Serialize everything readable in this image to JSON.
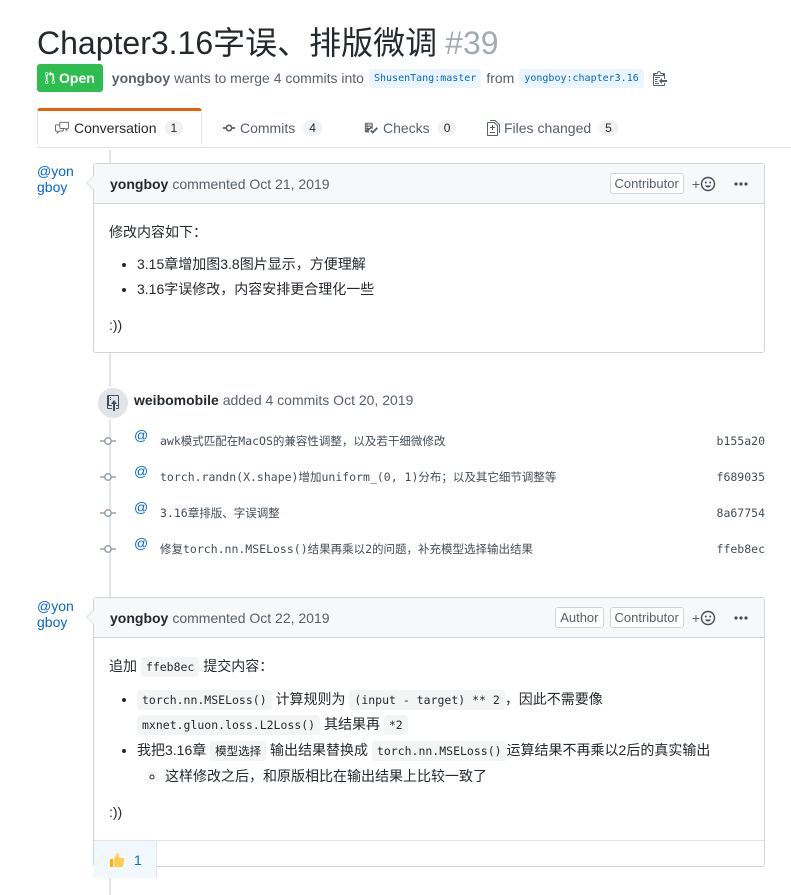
{
  "pr": {
    "title": "Chapter3.16字误、排版微调",
    "number": "#39",
    "state": "Open",
    "author": "yongboy",
    "merge_text": "wants to merge 4 commits into",
    "base_branch": "ShusenTang:master",
    "from_text": "from",
    "head_branch": "yongboy:chapter3.16"
  },
  "tabs": [
    {
      "label": "Conversation",
      "count": "1",
      "icon": "comment-discussion-icon"
    },
    {
      "label": "Commits",
      "count": "4",
      "icon": "git-commit-icon"
    },
    {
      "label": "Checks",
      "count": "0",
      "icon": "checklist-icon"
    },
    {
      "label": "Files changed",
      "count": "5",
      "icon": "file-diff-icon"
    }
  ],
  "comment1": {
    "avatar_line1": "@yon",
    "avatar_line2": "gboy",
    "author": "yongboy",
    "action": "commented Oct 21, 2019",
    "label": "Contributor",
    "intro": "修改内容如下：",
    "items": [
      "3.15章增加图3.8图片显示，方便理解",
      "3.16字误修改，内容安排更合理化一些"
    ],
    "outro": ":))"
  },
  "event": {
    "author": "weibomobile",
    "action": "added 4 commits Oct 20, 2019",
    "commits": [
      {
        "avatar": "@",
        "message": "awk模式匹配在MacOS的兼容性调整，以及若干细微修改",
        "sha": "b155a20"
      },
      {
        "avatar": "@",
        "message": "torch.randn(X.shape)增加uniform_(0, 1)分布；以及其它细节调整等",
        "sha": "f689035"
      },
      {
        "avatar": "@",
        "message": "3.16章排版、字误调整",
        "sha": "8a67754"
      },
      {
        "avatar": "@",
        "message": "修复torch.nn.MSELoss()结果再乘以2的问题，补充模型选择输出结果",
        "sha": "ffeb8ec"
      }
    ]
  },
  "comment2": {
    "avatar_line1": "@yon",
    "avatar_line2": "gboy",
    "author": "yongboy",
    "action": "commented Oct 22, 2019",
    "label_author": "Author",
    "label_contrib": "Contributor",
    "intro_prefix": "追加",
    "intro_code": "ffeb8ec",
    "intro_suffix": "提交内容：",
    "b1_code1": "torch.nn.MSELoss()",
    "b1_t1": "计算规则为",
    "b1_code2": "(input - target) ** 2",
    "b1_t2": "，因此不需要像",
    "b1_code3": "mxnet.gluon.loss.L2Loss()",
    "b1_t3": "其结果再",
    "b1_code4": "*2",
    "b2_t1": "我把3.16章",
    "b2_code1": "模型选择",
    "b2_t2": "输出结果替换成",
    "b2_code2": "torch.nn.MSELoss()",
    "b2_t3": "运算结果不再乘以2后的真实输出",
    "sub_item": "这样修改之后，和原版相比在输出结果上比较一致了",
    "outro": ":))",
    "reaction_count": "1"
  },
  "colors": {
    "open": "#2cbe4e",
    "link": "#0366d6",
    "tab_accent": "#e36209"
  }
}
